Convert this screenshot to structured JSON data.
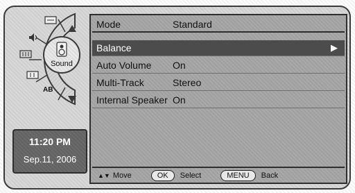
{
  "menu": {
    "mode": {
      "label": "Mode",
      "value": "Standard"
    },
    "items": [
      {
        "label": "Balance",
        "value": "",
        "arrow": "▶"
      },
      {
        "label": "Auto Volume",
        "value": "On",
        "arrow": ""
      },
      {
        "label": "Multi-Track",
        "value": "Stereo",
        "arrow": ""
      },
      {
        "label": "Internal Speaker",
        "value": "On",
        "arrow": ""
      }
    ]
  },
  "footer": {
    "move_symbol": "▲▼",
    "move_label": "Move",
    "ok_button": "OK",
    "select_label": "Select",
    "menu_button": "MENU",
    "back_label": "Back"
  },
  "clock": {
    "time": "11:20 PM",
    "date": "Sep.11, 2006"
  },
  "sidebar": {
    "current": "Sound",
    "icons": [
      "picture-icon",
      "sound-icon",
      "channel-icon",
      "setup-icon",
      "input-icon"
    ],
    "ab_label": "AB"
  }
}
